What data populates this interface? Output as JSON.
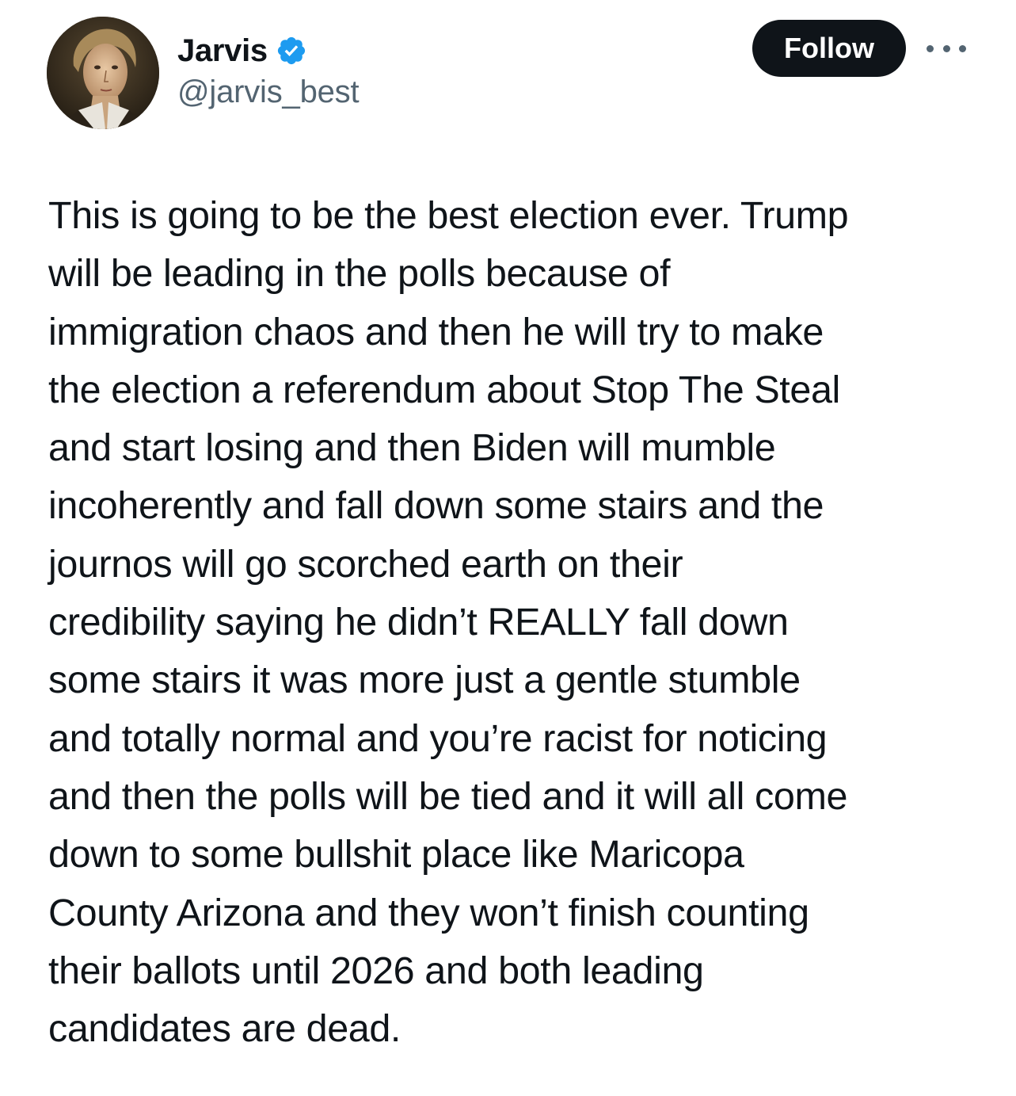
{
  "author": {
    "display_name": "Jarvis",
    "handle": "@jarvis_best",
    "verified": true,
    "verified_color": "#1d9bf0"
  },
  "actions": {
    "follow_label": "Follow",
    "more_icon": "more-horizontal-icon"
  },
  "tweet": {
    "lines": [
      "This is going to be the best election ever. Trump",
      "will be leading in the polls because of",
      "immigration chaos and then he will try to make",
      "the election a referendum about Stop The Steal",
      "and start losing and then Biden will mumble",
      "incoherently and fall down some stairs and the",
      "journos will go scorched earth on their",
      "credibility saying he didn’t REALLY fall down",
      "some stairs it was more just a gentle stumble",
      "and totally normal and you’re racist for noticing",
      "and then the polls will be tied and it will all come",
      "down to some bullshit place like Maricopa",
      "County Arizona and they won’t finish counting",
      "their ballots until 2026 and both leading",
      "candidates are dead."
    ]
  }
}
